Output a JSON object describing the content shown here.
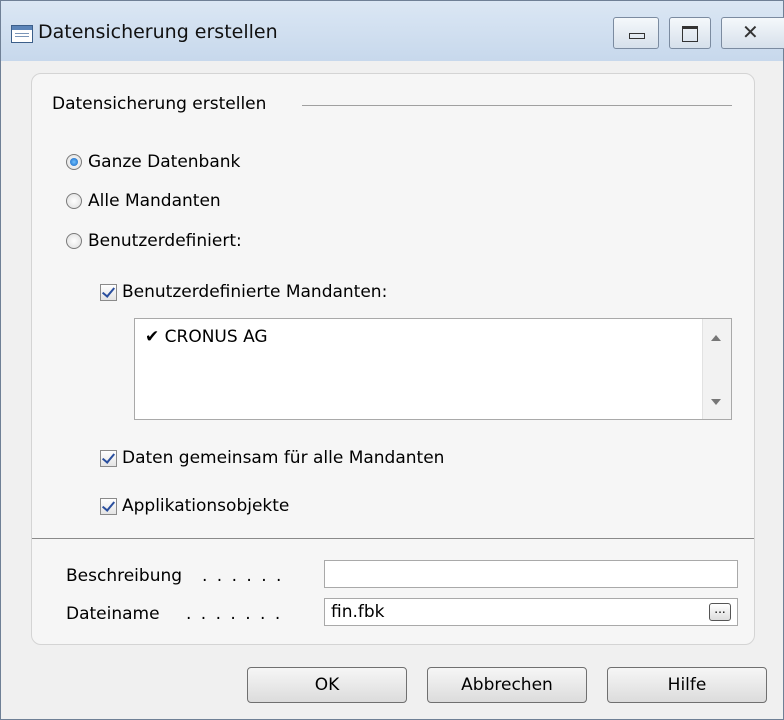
{
  "window": {
    "title": "Datensicherung erstellen"
  },
  "titlebar": {
    "minimize_icon": "minimize-icon",
    "maximize_icon": "maximize-icon",
    "close_icon": "close-icon",
    "close_glyph": "✕"
  },
  "group": {
    "title": "Datensicherung erstellen",
    "radios": [
      {
        "label": "Ganze Datenbank",
        "checked": true
      },
      {
        "label": "Alle Mandanten",
        "checked": false
      },
      {
        "label": "Benutzerdefiniert:",
        "checked": false
      }
    ],
    "custom_companies": {
      "label": "Benutzerdefinierte Mandanten:",
      "checked": true
    },
    "company_list": [
      {
        "check": "✔",
        "name": "CRONUS AG"
      }
    ],
    "shared_data": {
      "label": "Daten gemeinsam für alle Mandanten",
      "checked": true
    },
    "app_objects": {
      "label": "Applikationsobjekte",
      "checked": true
    }
  },
  "fields": {
    "description": {
      "label": "Beschreibung",
      "dots": ". . . . . .",
      "value": ""
    },
    "filename": {
      "label": "Dateiname",
      "dots": ". . . . . . .",
      "value": "fin.fbk",
      "browse": "..."
    }
  },
  "buttons": {
    "ok": "OK",
    "cancel": "Abbrechen",
    "help": "Hilfe"
  }
}
